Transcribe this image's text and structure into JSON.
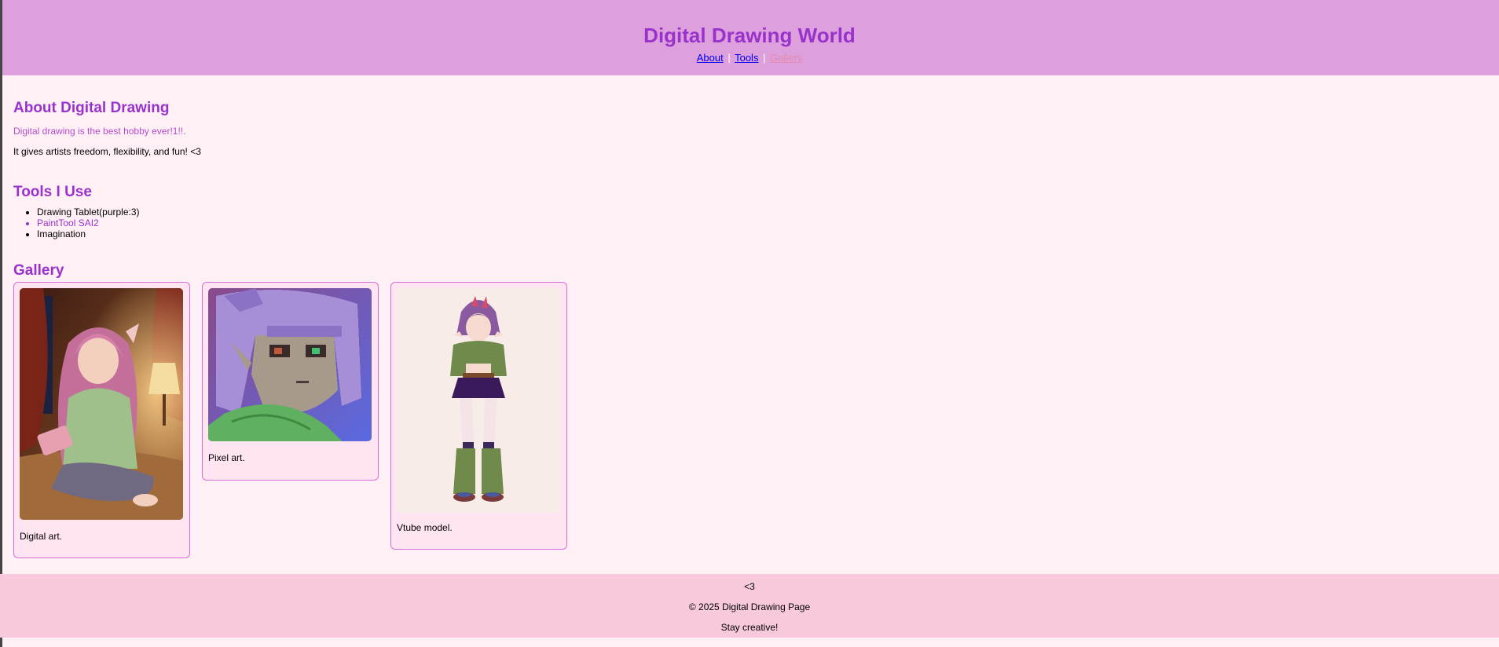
{
  "header": {
    "title": "Digital Drawing World"
  },
  "nav": {
    "about": "About",
    "tools": "Tools",
    "gallery": "Gallery",
    "separator": "|"
  },
  "about": {
    "heading": "About Digital Drawing",
    "intro": "Digital drawing is the best hobby ever!1!!.",
    "text": "It gives artists freedom, flexibility, and fun! <3"
  },
  "tools": {
    "heading": "Tools I Use",
    "items": [
      "Drawing Tablet(purple:3)",
      "PaintTool SAI2",
      "Imagination"
    ]
  },
  "gallery": {
    "heading": "Gallery",
    "items": [
      {
        "caption": "Digital art."
      },
      {
        "caption": "Pixel art."
      },
      {
        "caption": "Vtube model."
      }
    ]
  },
  "footer": {
    "heart": "<3",
    "copyright": "© 2025 Digital Drawing Page",
    "tagline": "Stay creative!"
  },
  "colors": {
    "header_bg": "#dda0dd",
    "accent": "#9932cc",
    "page_bg": "#fff0f5",
    "footer_bg": "#f8c8dc"
  }
}
